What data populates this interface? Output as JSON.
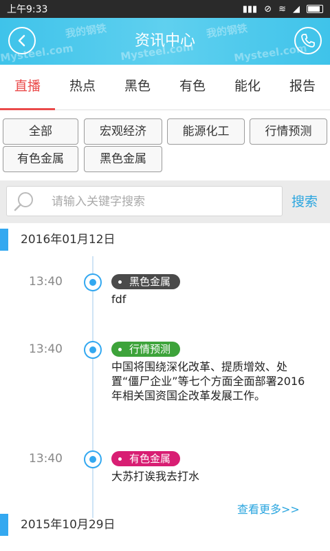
{
  "status": {
    "time": "上午9:33"
  },
  "header": {
    "title": "资讯中心",
    "watermark": "Mysteel.com",
    "watermark_cn": "我的钢铁"
  },
  "tabs": [
    "直播",
    "热点",
    "黑色",
    "有色",
    "能化",
    "报告"
  ],
  "filters": [
    "全部",
    "宏观经济",
    "能源化工",
    "行情预测",
    "有色金属",
    "黑色金属"
  ],
  "search": {
    "placeholder": "请输入关键字搜索",
    "button": "搜索"
  },
  "dates": [
    "2016年01月12日",
    "2015年10月29日"
  ],
  "items": [
    {
      "time": "13:40",
      "tag": "黑色金属",
      "tag_color": "#4a4a4a",
      "content": "fdf"
    },
    {
      "time": "13:40",
      "tag": "行情预测",
      "tag_color": "#3da33a",
      "content": "中国将围绕深化改革、提质增效、处置“僵尸企业”等七个方面全面部署2016年相关国资国企改革发展工作。"
    },
    {
      "time": "13:40",
      "tag": "有色金属",
      "tag_color": "#d81e73",
      "content": "大苏打诶我去打水"
    }
  ],
  "more": "查看更多>>"
}
